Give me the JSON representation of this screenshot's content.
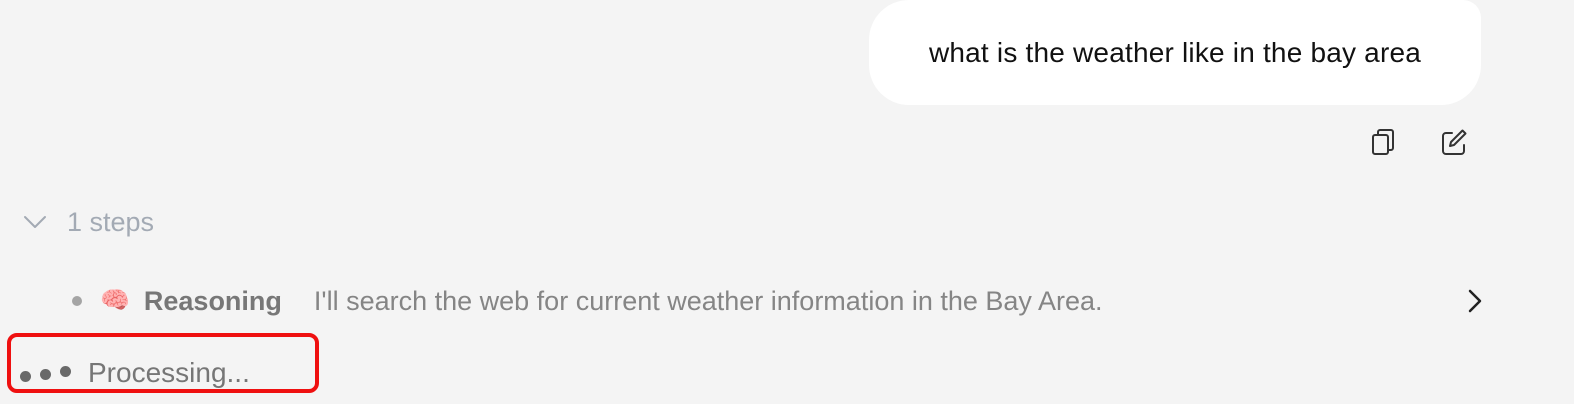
{
  "user_message": {
    "text": "what is the weather like in the bay area"
  },
  "message_actions": {
    "copy_icon": "copy-icon",
    "edit_icon": "edit-icon"
  },
  "steps": {
    "label": "1 steps",
    "expanded": true,
    "items": [
      {
        "emoji": "🧠",
        "title": "Reasoning",
        "text": "I'll search the web for current weather information in the Bay Area."
      }
    ]
  },
  "status": {
    "text": "Processing..."
  },
  "colors": {
    "background": "#f4f4f4",
    "bubble": "#ffffff",
    "highlight": "#ef1010"
  }
}
